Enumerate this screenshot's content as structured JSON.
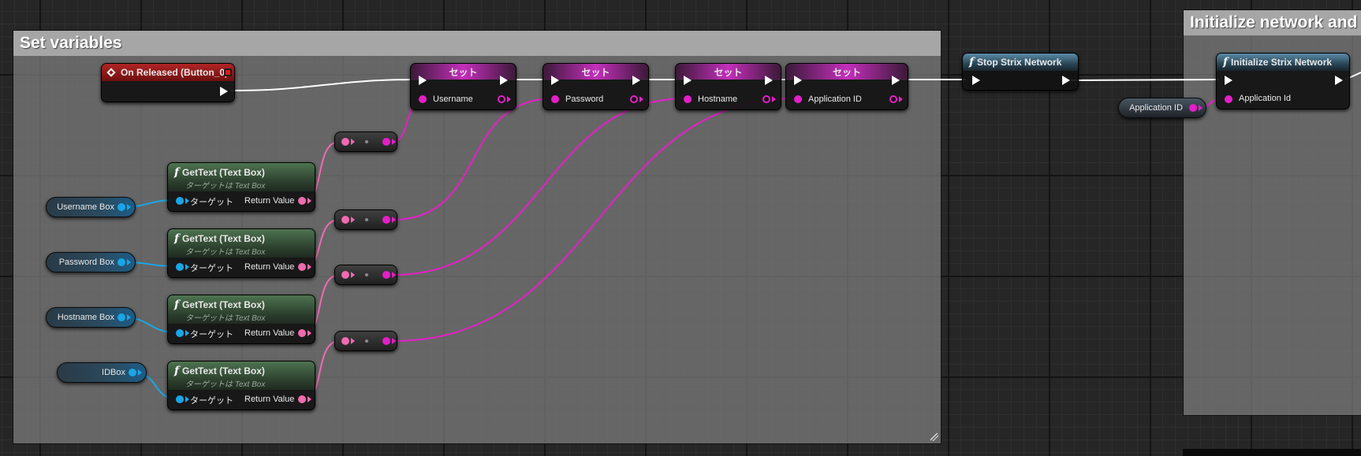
{
  "comments": {
    "set_variables": "Set variables",
    "initialize": "Initialize network and C"
  },
  "event_node": {
    "title": "On Released (Button_0)"
  },
  "set_title": "セット",
  "set_nodes": [
    {
      "pin": "Username"
    },
    {
      "pin": "Password"
    },
    {
      "pin": "Hostname"
    },
    {
      "pin": "Application ID"
    }
  ],
  "stop_node": {
    "title": "Stop Strix Network"
  },
  "init_node": {
    "title": "Initialize Strix Network",
    "pin": "Application Id"
  },
  "app_id_var": "Application ID",
  "gettext": {
    "title": "GetText (Text Box)",
    "subtitle_prefix": "ターゲットは",
    "subtitle_target": "Text Box",
    "target_pin": "ターゲット",
    "return_pin": "Return Value"
  },
  "box_vars": [
    "Username Box",
    "Password Box",
    "Hostname Box",
    "IDBox"
  ],
  "colors": {
    "exec_wire": "#ffffff",
    "string_wire": "#e51fc8",
    "text_wire": "#f06ab0",
    "object_wire": "#19a6e6",
    "event_header": "#b02424"
  },
  "icons": {
    "function": "function-f-icon",
    "event": "event-diamond-icon",
    "exec": "exec-arrow-icon"
  }
}
